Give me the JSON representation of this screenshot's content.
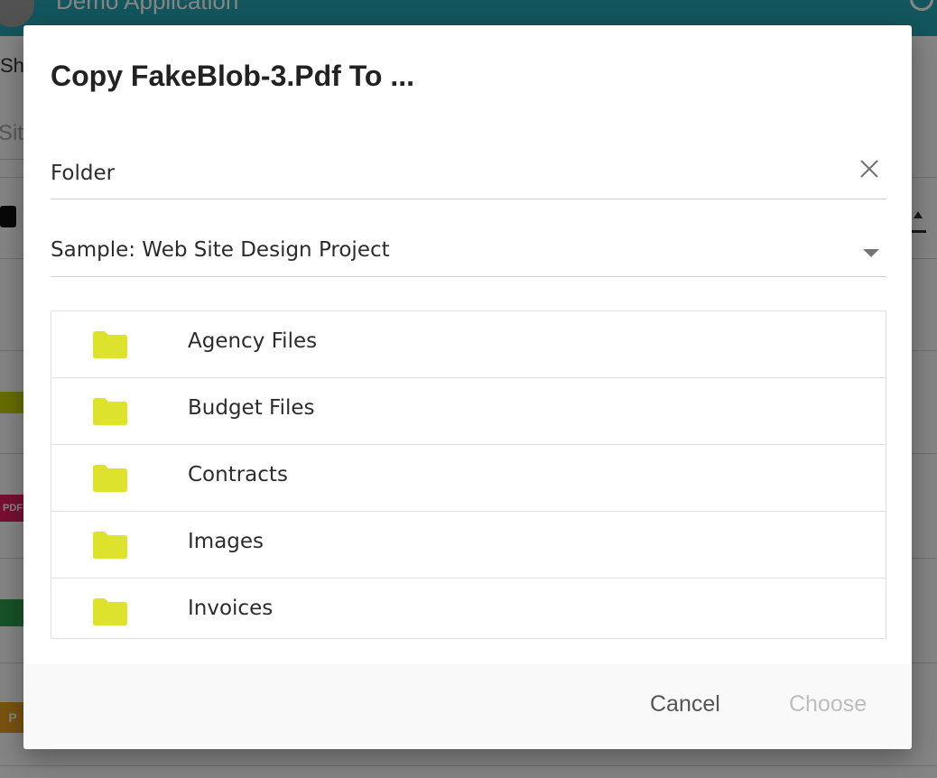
{
  "background_app": {
    "app_title": "Demo Application",
    "breadcrumb": "Sho",
    "search_placeholder": "Site",
    "pdf_badge": "PDF",
    "ppt_badge": "P"
  },
  "dialog": {
    "title": "Copy FakeBlob-3.Pdf To ...",
    "folder_field": {
      "placeholder": "Folder",
      "value": ""
    },
    "site_select": {
      "selected": "Sample: Web Site Design Project"
    },
    "folders": [
      {
        "label": "Agency Files",
        "icon": "folder-icon"
      },
      {
        "label": "Budget Files",
        "icon": "folder-icon"
      },
      {
        "label": "Contracts",
        "icon": "folder-icon"
      },
      {
        "label": "Images",
        "icon": "folder-icon"
      },
      {
        "label": "Invoices",
        "icon": "folder-icon"
      }
    ],
    "actions": {
      "cancel_label": "Cancel",
      "choose_label": "Choose",
      "choose_disabled": true
    }
  },
  "colors": {
    "header_teal": "#26a6b3",
    "folder_yellow": "#dde22c",
    "cancel_text": "#555555",
    "choose_disabled_text": "#bdbdbd"
  }
}
